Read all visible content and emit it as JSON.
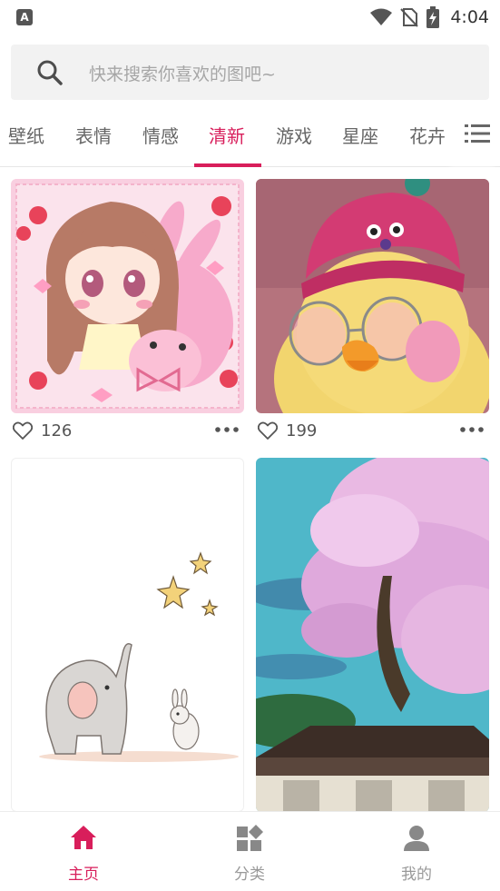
{
  "status_bar": {
    "time": "4:04",
    "left_icon": "A",
    "icons": [
      "wifi-icon",
      "no-sim-icon",
      "battery-charging-icon"
    ]
  },
  "search": {
    "placeholder": "快来搜索你喜欢的图吧~",
    "icon": "search-icon"
  },
  "tabs": {
    "items": [
      "壁纸",
      "表情",
      "情感",
      "清新",
      "游戏",
      "星座",
      "花卉"
    ],
    "active_index": 3,
    "menu_icon": "list-menu-icon"
  },
  "feed": {
    "items": [
      {
        "image": "anime-girl-pink-bunny",
        "likes": "126"
      },
      {
        "image": "yellow-duck-pink-hat",
        "likes": "199"
      },
      {
        "image": "elephant-and-bunny-stars",
        "likes": ""
      },
      {
        "image": "cherry-blossom-tree-house",
        "likes": ""
      }
    ]
  },
  "bottom_nav": {
    "items": [
      {
        "label": "主页",
        "icon": "home-icon",
        "active": true
      },
      {
        "label": "分类",
        "icon": "category-icon",
        "active": false
      },
      {
        "label": "我的",
        "icon": "profile-icon",
        "active": false
      }
    ]
  },
  "colors": {
    "accent": "#d81e5b",
    "inactive_text": "#666666",
    "search_bg": "#f2f2f2"
  }
}
